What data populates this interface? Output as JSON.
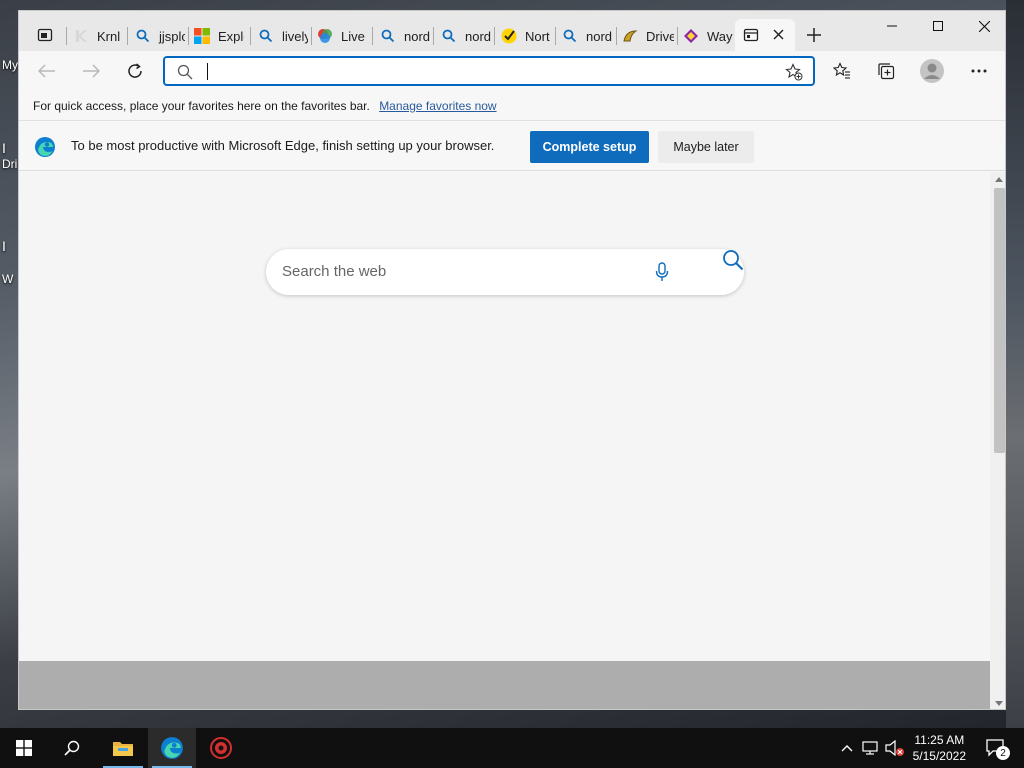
{
  "desktop": {
    "frag1": "My",
    "frag2": "I",
    "frag3": "Dri",
    "frag4": "I",
    "frag5": "W"
  },
  "tabs": [
    {
      "label": "Krnl"
    },
    {
      "label": "jjsplo"
    },
    {
      "label": "Explo"
    },
    {
      "label": "lively"
    },
    {
      "label": "Live"
    },
    {
      "label": "nord"
    },
    {
      "label": "nord"
    },
    {
      "label": "Nort"
    },
    {
      "label": "nord"
    },
    {
      "label": "Drive"
    },
    {
      "label": "Way"
    }
  ],
  "address": {
    "value": "",
    "placeholder": ""
  },
  "favorites_bar": {
    "message": "For quick access, place your favorites here on the favorites bar.",
    "link": "Manage favorites now"
  },
  "infobar": {
    "message": "To be most productive with Microsoft Edge, finish setting up your browser.",
    "primary": "Complete setup",
    "secondary": "Maybe later"
  },
  "newtab": {
    "search_placeholder": "Search the web"
  },
  "taskbar": {
    "time": "11:25 AM",
    "date": "5/15/2022",
    "notifications": "2"
  },
  "colors": {
    "accent": "#0f6cbd",
    "focus": "#0067c0"
  }
}
